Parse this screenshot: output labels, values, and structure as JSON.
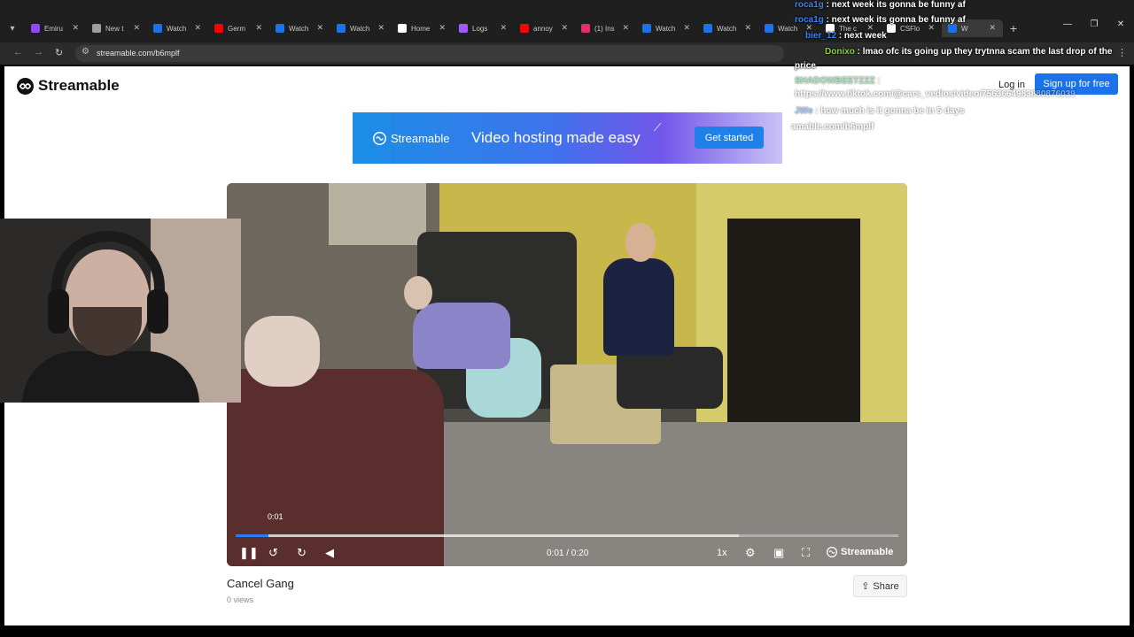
{
  "browser": {
    "tabs": [
      {
        "label": "Emiru",
        "favicon_color": "#9146ff"
      },
      {
        "label": "New t",
        "favicon_color": "#9aa0a6"
      },
      {
        "label": "Watch",
        "favicon_color": "#1a73e8"
      },
      {
        "label": "Germ",
        "favicon_color": "#ff0000"
      },
      {
        "label": "Watch",
        "favicon_color": "#1a73e8"
      },
      {
        "label": "Watch",
        "favicon_color": "#1a73e8"
      },
      {
        "label": "Home",
        "favicon_color": "#ffffff"
      },
      {
        "label": "Logs",
        "favicon_color": "#a259ff"
      },
      {
        "label": "annoy",
        "favicon_color": "#ff0000"
      },
      {
        "label": "(1) Ins",
        "favicon_color": "#e1306c"
      },
      {
        "label": "Watch",
        "favicon_color": "#1a73e8"
      },
      {
        "label": "Watch",
        "favicon_color": "#1a73e8"
      },
      {
        "label": "Watch",
        "favicon_color": "#1a73e8"
      },
      {
        "label": "The c",
        "favicon_color": "#ffffff"
      },
      {
        "label": "CSFlo",
        "favicon_color": "#ffffff"
      },
      {
        "label": "W",
        "favicon_color": "#1a73e8"
      }
    ],
    "active_tab_index": 15,
    "url": "streamable.com/b6mplf"
  },
  "site": {
    "logo_text": "Streamable",
    "login_label": "Log in",
    "signup_label": "Sign up for free"
  },
  "ad": {
    "brand": "Streamable",
    "tagline": "Video hosting made easy",
    "cta": "Get started"
  },
  "player": {
    "hover_time": "0:01",
    "time_display": "0:01 / 0:20",
    "current_seconds": 1,
    "duration_seconds": 20,
    "buffered_fraction": 0.76,
    "speed": "1x",
    "watermark": "Streamable",
    "progress_color": "#2d7cf2"
  },
  "video_info": {
    "title": "Cancel Gang",
    "views": "0 views",
    "share_label": "Share"
  },
  "chat": [
    {
      "user": "roca1g",
      "text": ": next week its gonna be funny af",
      "dim": false
    },
    {
      "user": "roca1g",
      "text": ": next week its gonna be funny af",
      "dim": false
    },
    {
      "user": "bier_12",
      "text": ": next week",
      "dim": false
    },
    {
      "user": "Donixo",
      "text": ": lmao ofc its going up they trytnna scam the last drop of the",
      "dim": false
    },
    {
      "user": "",
      "text": "price",
      "dim": false
    },
    {
      "user": "SHADOWBEETZZZ",
      "text": ":",
      "dim": true
    },
    {
      "user": "",
      "text": "https://www.tiktok.com/@cars_vedios/video/7563664983880876039",
      "dim": true
    },
    {
      "user": "JWe",
      "text": ": how much is it gonna be in 5 days",
      "dim": true
    },
    {
      "user": "",
      "text": "amable.com/b6mplf",
      "dim": true
    }
  ]
}
